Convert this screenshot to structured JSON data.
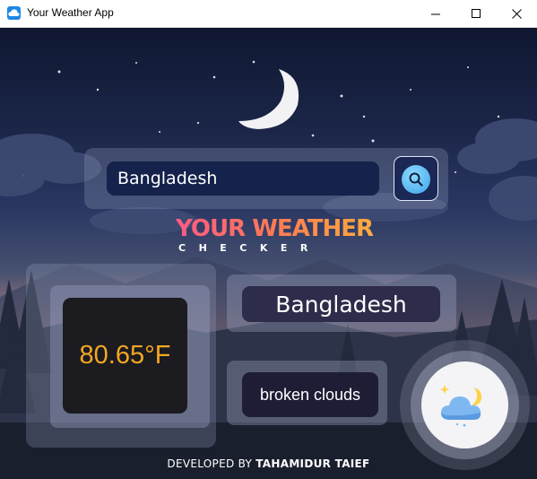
{
  "window": {
    "title": "Your Weather App",
    "minimize_icon": "minimize-icon",
    "maximize_icon": "maximize-icon",
    "close_icon": "close-icon"
  },
  "search": {
    "value": "Bangladesh",
    "button_icon": "search-icon"
  },
  "logo": {
    "title": "YOUR WEATHER",
    "subtitle": "CHECKER"
  },
  "weather": {
    "temperature": "80.65°F",
    "country": "Bangladesh",
    "description": "broken clouds",
    "icon": "cloud-moon-icon"
  },
  "footer": {
    "prefix": "DEVELOPED BY",
    "author": "TAHAMIDUR TAIEF"
  },
  "colors": {
    "accent_temperature": "#f5a623",
    "search_button": "#3ba2e8",
    "title_bar_icon": "#1e88e5"
  }
}
